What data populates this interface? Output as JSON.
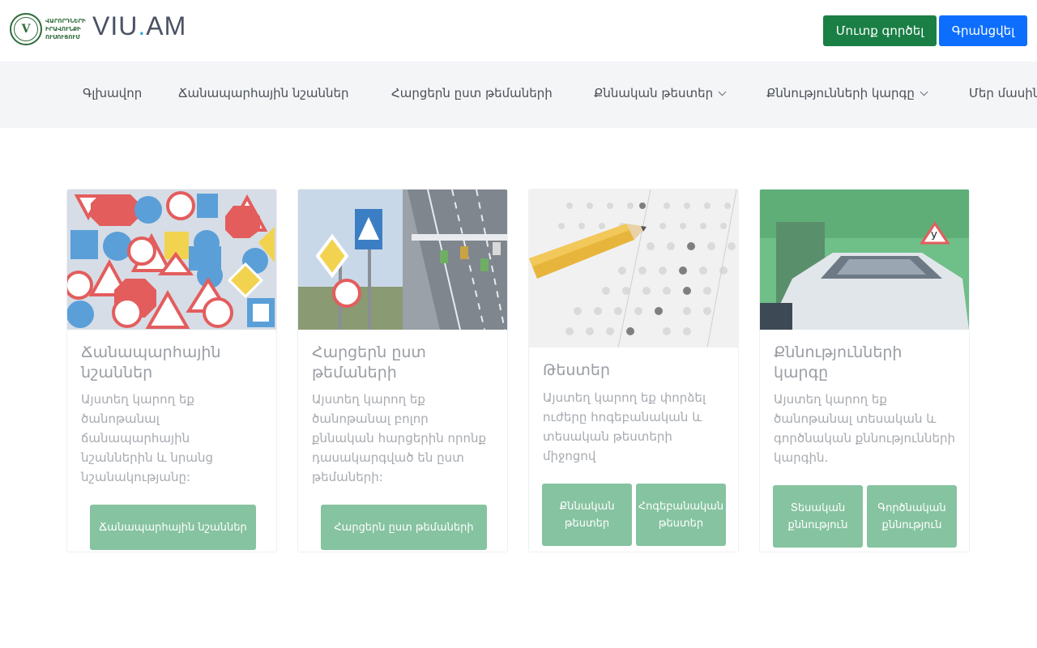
{
  "header": {
    "org_lines": [
      "ՎԱՐՈՐԴՆԵՐԻ",
      "ԻՐԱՎՈՒՆՔԻ",
      "ՈՒՍՈՒՑՈՒՄ"
    ],
    "seal_letter": "V",
    "brand_left": "VIU",
    "brand_dot": ".",
    "brand_right": "AM",
    "login_label": "Մուտք գործել",
    "register_label": "Գրանցվել"
  },
  "nav": {
    "items": [
      {
        "label": "Գլխավոր"
      },
      {
        "label": "Ճանապարհային նշաններ"
      },
      {
        "label": "Հարցերն ըստ թեմաների"
      },
      {
        "label": "Քննական թեստեր"
      },
      {
        "label": "Քննությունների կարգը"
      },
      {
        "label": "Մեր մասին"
      }
    ]
  },
  "cards": [
    {
      "title": "Ճանապարհային նշաններ",
      "text": "Այստեղ կարող եք ծանոթանալ ճանապարհային նշաններին և նրանց նշանակությանը:",
      "buttons": [
        "Ճանապարհային նշաններ"
      ]
    },
    {
      "title": "Հարցերն ըստ թեմաների",
      "text": "Այստեղ կարող եք ծանոթանալ բոլոր քննական հարցերին որոնք դասակարգված են ըստ թեմաների:",
      "buttons": [
        "Հարցերն ըստ թեմաների"
      ]
    },
    {
      "title": "Թեստեր",
      "text": "Այստեղ կարող եք փորձել ուժերը հոգեբանական և տեսական թեստերի միջոցով",
      "buttons": [
        "Քննական թեստեր",
        "Հոգեբանական թեստեր"
      ]
    },
    {
      "title": "Քննությունների կարգը",
      "text": "Այստեղ կարող եք ծանոթանալ տեսական և գործնական քննությունների կարգին.",
      "buttons": [
        "Տեսական քննություն",
        "Գործնական քննություն"
      ]
    }
  ],
  "colors": {
    "login_button": "#1a7f45",
    "register_button": "#0d6efd",
    "card_button": "#86c3a0",
    "nav_background": "#f4f5f7",
    "brand_dot": "#2aa9e0"
  },
  "icons": {
    "seal": "organization-seal-icon",
    "nav_dropdown": "chevron-down-icon"
  }
}
